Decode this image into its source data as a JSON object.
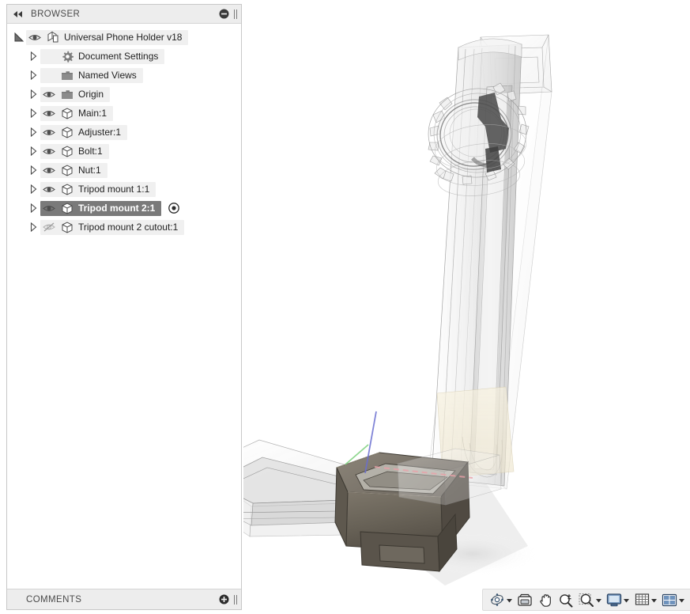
{
  "browser": {
    "title": "BROWSER",
    "collapse_icon": "double-left-arrow-icon",
    "minimize_icon": "minus-circle-icon",
    "tree": [
      {
        "label": "Universal Phone Holder v18",
        "icon": "document-component-icon",
        "depth": 0,
        "expanded": true,
        "visible": true,
        "has_eye": true,
        "selected": false,
        "activated": false
      },
      {
        "label": "Document Settings",
        "icon": "gear-icon",
        "depth": 1,
        "expanded": false,
        "visible": true,
        "has_eye": false,
        "selected": false,
        "activated": false
      },
      {
        "label": "Named Views",
        "icon": "folder-icon",
        "depth": 1,
        "expanded": false,
        "visible": true,
        "has_eye": false,
        "selected": false,
        "activated": false
      },
      {
        "label": "Origin",
        "icon": "folder-icon",
        "depth": 1,
        "expanded": false,
        "visible": true,
        "has_eye": true,
        "selected": false,
        "activated": false
      },
      {
        "label": "Main:1",
        "icon": "component-cube-icon",
        "depth": 1,
        "expanded": false,
        "visible": true,
        "has_eye": true,
        "selected": false,
        "activated": false
      },
      {
        "label": "Adjuster:1",
        "icon": "component-cube-icon",
        "depth": 1,
        "expanded": false,
        "visible": true,
        "has_eye": true,
        "selected": false,
        "activated": false
      },
      {
        "label": "Bolt:1",
        "icon": "component-cube-icon",
        "depth": 1,
        "expanded": false,
        "visible": true,
        "has_eye": true,
        "selected": false,
        "activated": false
      },
      {
        "label": "Nut:1",
        "icon": "component-cube-icon",
        "depth": 1,
        "expanded": false,
        "visible": true,
        "has_eye": true,
        "selected": false,
        "activated": false
      },
      {
        "label": "Tripod mount 1:1",
        "icon": "component-cube-icon",
        "depth": 1,
        "expanded": false,
        "visible": true,
        "has_eye": true,
        "selected": false,
        "activated": false
      },
      {
        "label": "Tripod mount 2:1",
        "icon": "component-cube-icon",
        "depth": 1,
        "expanded": false,
        "visible": true,
        "has_eye": true,
        "selected": true,
        "activated": true
      },
      {
        "label": "Tripod mount 2 cutout:1",
        "icon": "component-cube-icon",
        "depth": 1,
        "expanded": false,
        "visible": false,
        "has_eye": true,
        "selected": false,
        "activated": false
      }
    ]
  },
  "comments": {
    "title": "COMMENTS",
    "add_icon": "plus-circle-icon"
  },
  "navbar": {
    "items": [
      {
        "name": "orbit-tool",
        "icon": "orbit-icon",
        "has_dropdown": true
      },
      {
        "name": "look-at-tool",
        "icon": "look-at-icon",
        "has_dropdown": false
      },
      {
        "name": "pan-tool",
        "icon": "hand-pan-icon",
        "has_dropdown": false
      },
      {
        "name": "zoom-tool",
        "icon": "magnifier-plus-minus-icon",
        "has_dropdown": false
      },
      {
        "name": "zoom-window-tool",
        "icon": "magnifier-window-icon",
        "has_dropdown": true
      },
      {
        "name": "display-settings",
        "icon": "monitor-icon",
        "has_dropdown": true
      },
      {
        "name": "grid-and-snaps",
        "icon": "grid-icon",
        "has_dropdown": true
      },
      {
        "name": "viewport-layout",
        "icon": "four-pane-layout-icon",
        "has_dropdown": true
      }
    ]
  },
  "viewport": {
    "name": "3d-model-canvas",
    "background": "#ffffff",
    "model_title": "Universal Phone Holder v18",
    "colors": {
      "ghost_body": "#d8d8d8",
      "selected_body": "#6b6459",
      "sketch_plane": "#f3ecd9",
      "axis_z": "#6a6fd0",
      "axis_y": "#7dd07d",
      "axis_x": "#e8a0a8",
      "shadow": "#d9d9d9"
    }
  }
}
